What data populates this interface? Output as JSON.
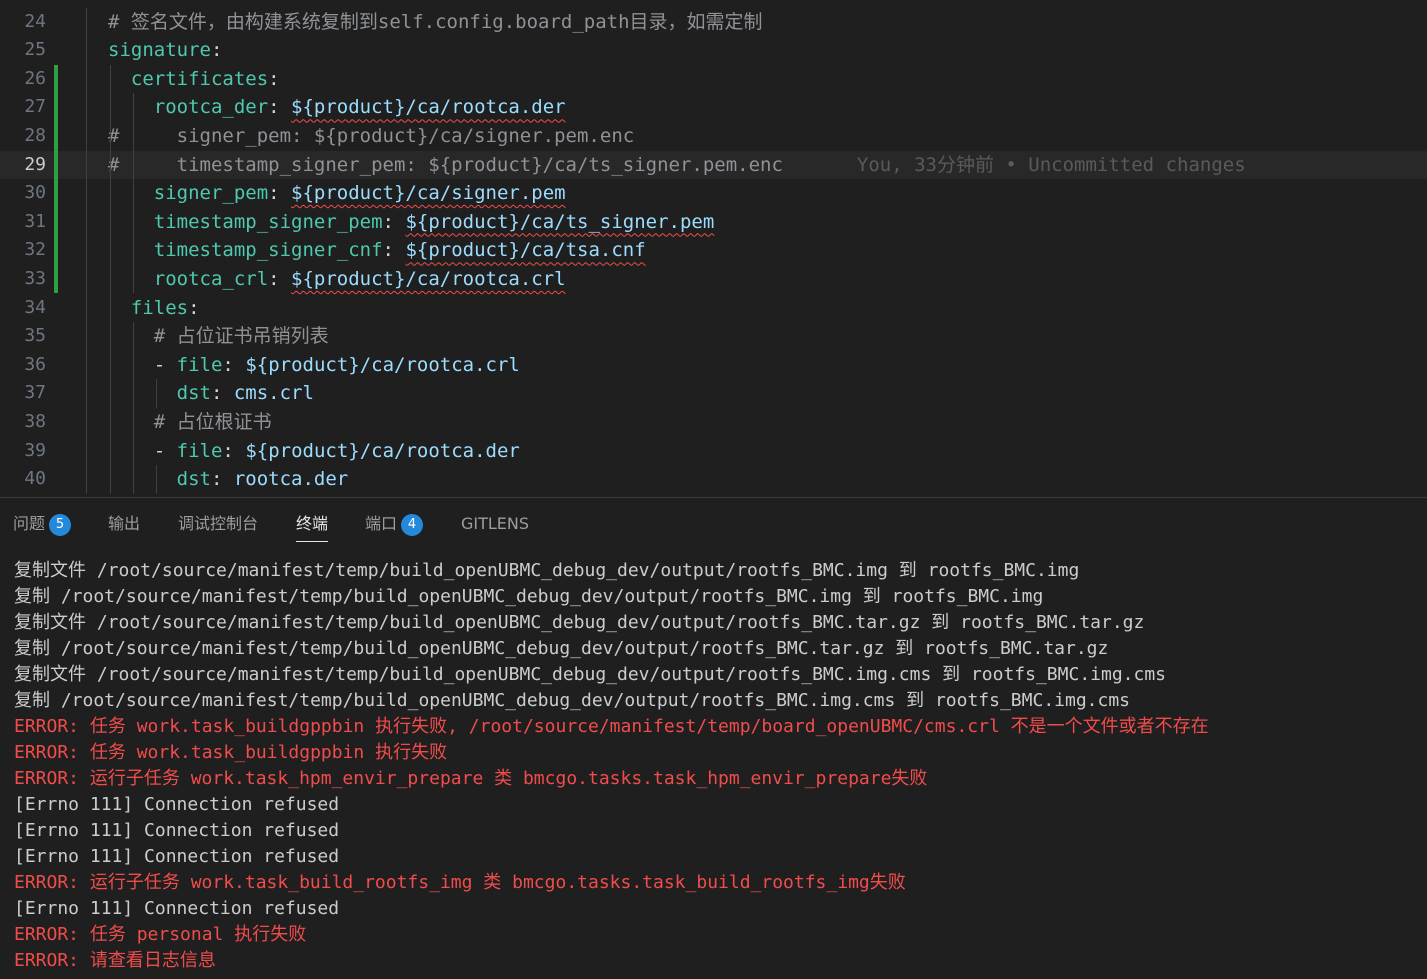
{
  "editor": {
    "lines": [
      {
        "num": "24",
        "indent": "",
        "segments": [
          {
            "t": "# 签名文件，由构建系统复制到self.config.board_path目录，如需定制",
            "c": "c",
            "sq": false
          }
        ]
      },
      {
        "num": "25",
        "indent": "",
        "segments": [
          {
            "t": "signature",
            "c": "k",
            "sq": false
          },
          {
            "t": ":",
            "c": "p",
            "sq": false
          }
        ]
      },
      {
        "num": "26",
        "indent": "  ",
        "segments": [
          {
            "t": "certificates",
            "c": "k",
            "sq": false
          },
          {
            "t": ":",
            "c": "p",
            "sq": false
          }
        ]
      },
      {
        "num": "27",
        "indent": "    ",
        "segments": [
          {
            "t": "rootca_der",
            "c": "k",
            "sq": false
          },
          {
            "t": ": ",
            "c": "p",
            "sq": false
          },
          {
            "t": "${product}/ca/rootca.der",
            "c": "v",
            "sq": true
          }
        ]
      },
      {
        "num": "28",
        "indent": "",
        "segments": [
          {
            "t": "#     signer_pem: ${product}/ca/signer.pem.enc",
            "c": "c",
            "sq": false
          }
        ]
      },
      {
        "num": "29",
        "indent": "",
        "segments": [
          {
            "t": "#     timestamp_signer_pem: ${product}/ca/ts_signer.pem.enc",
            "c": "c",
            "sq": false
          }
        ],
        "blame": "You, 33分钟前 • Uncommitted changes",
        "current": true
      },
      {
        "num": "30",
        "indent": "    ",
        "segments": [
          {
            "t": "signer_pem",
            "c": "k",
            "sq": false
          },
          {
            "t": ": ",
            "c": "p",
            "sq": false
          },
          {
            "t": "${product}/ca/signer.pem",
            "c": "v",
            "sq": true
          }
        ]
      },
      {
        "num": "31",
        "indent": "    ",
        "segments": [
          {
            "t": "timestamp_signer_pem",
            "c": "k",
            "sq": false
          },
          {
            "t": ": ",
            "c": "p",
            "sq": false
          },
          {
            "t": "${product}/ca/ts_signer.pem",
            "c": "v",
            "sq": true
          }
        ]
      },
      {
        "num": "32",
        "indent": "    ",
        "segments": [
          {
            "t": "timestamp_signer_cnf",
            "c": "k",
            "sq": false
          },
          {
            "t": ": ",
            "c": "p",
            "sq": false
          },
          {
            "t": "${product}/ca/tsa.cnf",
            "c": "v",
            "sq": true
          }
        ]
      },
      {
        "num": "33",
        "indent": "    ",
        "segments": [
          {
            "t": "rootca_crl",
            "c": "k",
            "sq": false
          },
          {
            "t": ": ",
            "c": "p",
            "sq": false
          },
          {
            "t": "${product}/ca/rootca.crl",
            "c": "v",
            "sq": true
          }
        ]
      },
      {
        "num": "34",
        "indent": "  ",
        "segments": [
          {
            "t": "files",
            "c": "k",
            "sq": false
          },
          {
            "t": ":",
            "c": "p",
            "sq": false
          }
        ]
      },
      {
        "num": "35",
        "indent": "    ",
        "segments": [
          {
            "t": "# 占位证书吊销列表",
            "c": "c",
            "sq": false
          }
        ]
      },
      {
        "num": "36",
        "indent": "    ",
        "segments": [
          {
            "t": "- ",
            "c": "p",
            "sq": false
          },
          {
            "t": "file",
            "c": "k",
            "sq": false
          },
          {
            "t": ": ",
            "c": "p",
            "sq": false
          },
          {
            "t": "${product}/ca/rootca.crl",
            "c": "v",
            "sq": false
          }
        ]
      },
      {
        "num": "37",
        "indent": "      ",
        "segments": [
          {
            "t": "dst",
            "c": "k",
            "sq": false
          },
          {
            "t": ": ",
            "c": "p",
            "sq": false
          },
          {
            "t": "cms.crl",
            "c": "v",
            "sq": false
          }
        ]
      },
      {
        "num": "38",
        "indent": "    ",
        "segments": [
          {
            "t": "# 占位根证书",
            "c": "c",
            "sq": false
          }
        ]
      },
      {
        "num": "39",
        "indent": "    ",
        "segments": [
          {
            "t": "- ",
            "c": "p",
            "sq": false
          },
          {
            "t": "file",
            "c": "k",
            "sq": false
          },
          {
            "t": ": ",
            "c": "p",
            "sq": false
          },
          {
            "t": "${product}/ca/rootca.der",
            "c": "v",
            "sq": false
          }
        ]
      },
      {
        "num": "40",
        "indent": "      ",
        "segments": [
          {
            "t": "dst",
            "c": "k",
            "sq": false
          },
          {
            "t": ": ",
            "c": "p",
            "sq": false
          },
          {
            "t": "rootca.der",
            "c": "v",
            "sq": false
          }
        ]
      }
    ]
  },
  "panel": {
    "tabs": [
      {
        "label": "问题",
        "badge": "5",
        "active": false
      },
      {
        "label": "输出",
        "badge": "",
        "active": false
      },
      {
        "label": "调试控制台",
        "badge": "",
        "active": false
      },
      {
        "label": "终端",
        "badge": "",
        "active": true
      },
      {
        "label": "端口",
        "badge": "4",
        "active": false
      },
      {
        "label": "GITLENS",
        "badge": "",
        "active": false
      }
    ]
  },
  "terminal": {
    "lines": [
      {
        "text": "复制文件 /root/source/manifest/temp/build_openUBMC_debug_dev/output/rootfs_BMC.img 到 rootfs_BMC.img",
        "error": false
      },
      {
        "text": "复制 /root/source/manifest/temp/build_openUBMC_debug_dev/output/rootfs_BMC.img 到 rootfs_BMC.img",
        "error": false
      },
      {
        "text": "复制文件 /root/source/manifest/temp/build_openUBMC_debug_dev/output/rootfs_BMC.tar.gz 到 rootfs_BMC.tar.gz",
        "error": false
      },
      {
        "text": "复制 /root/source/manifest/temp/build_openUBMC_debug_dev/output/rootfs_BMC.tar.gz 到 rootfs_BMC.tar.gz",
        "error": false
      },
      {
        "text": "复制文件 /root/source/manifest/temp/build_openUBMC_debug_dev/output/rootfs_BMC.img.cms 到 rootfs_BMC.img.cms",
        "error": false
      },
      {
        "text": "复制 /root/source/manifest/temp/build_openUBMC_debug_dev/output/rootfs_BMC.img.cms 到 rootfs_BMC.img.cms",
        "error": false
      },
      {
        "text": "ERROR: 任务 work.task_buildgppbin 执行失败, /root/source/manifest/temp/board_openUBMC/cms.crl 不是一个文件或者不存在",
        "error": true
      },
      {
        "text": "ERROR: 任务 work.task_buildgppbin 执行失败",
        "error": true
      },
      {
        "text": "ERROR: 运行子任务 work.task_hpm_envir_prepare 类 bmcgo.tasks.task_hpm_envir_prepare失败",
        "error": true
      },
      {
        "text": "[Errno 111] Connection refused",
        "error": false
      },
      {
        "text": "[Errno 111] Connection refused",
        "error": false
      },
      {
        "text": "[Errno 111] Connection refused",
        "error": false
      },
      {
        "text": "ERROR: 运行子任务 work.task_build_rootfs_img 类 bmcgo.tasks.task_build_rootfs_img失败",
        "error": true
      },
      {
        "text": "[Errno 111] Connection refused",
        "error": false
      },
      {
        "text": "ERROR: 任务 personal 执行失败",
        "error": true
      },
      {
        "text": "ERROR: 请查看日志信息",
        "error": true
      }
    ]
  }
}
